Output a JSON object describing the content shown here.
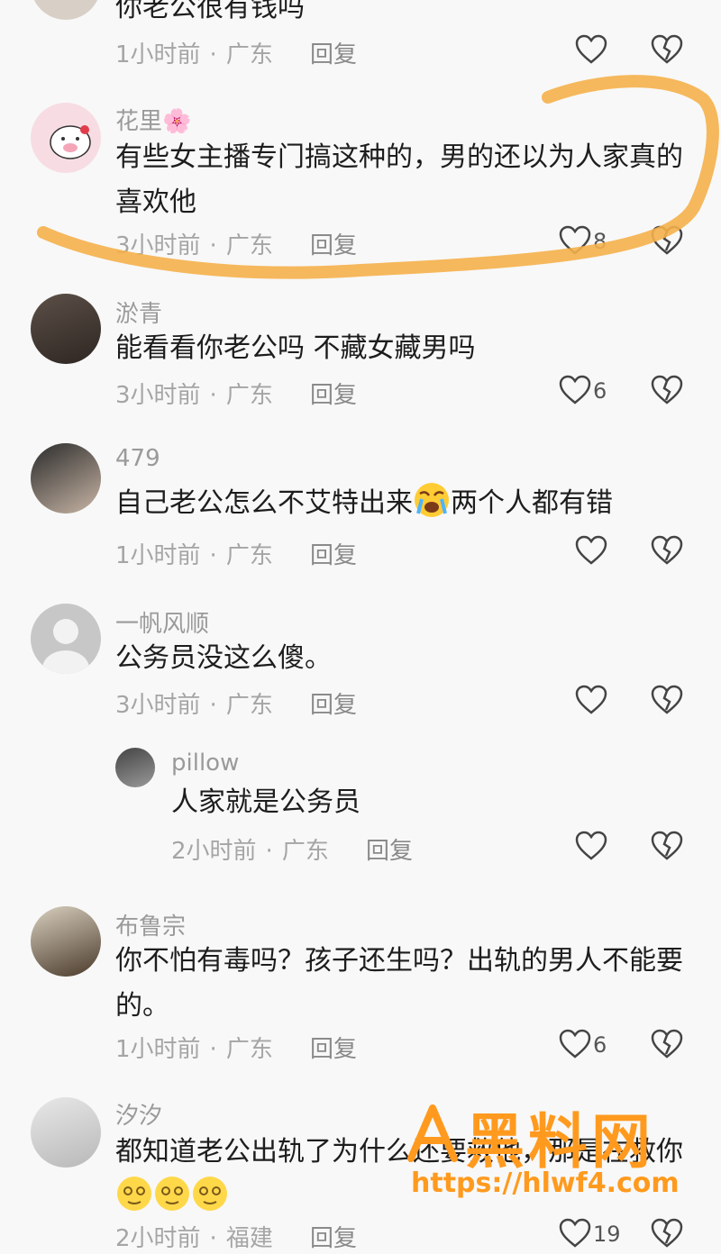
{
  "comments": [
    {
      "username": "",
      "text": "你老公很有钱吗",
      "time": "1小时前",
      "location": "广东",
      "reply": "回复",
      "likes": ""
    },
    {
      "username": "花里🌸",
      "text": "有些女主播专门搞这种的，男的还以为人家真的喜欢他",
      "time": "3小时前",
      "location": "广东",
      "reply": "回复",
      "likes": "8"
    },
    {
      "username": "淤青",
      "text": "能看看你老公吗 不藏女藏男吗",
      "time": "3小时前",
      "location": "广东",
      "reply": "回复",
      "likes": "6"
    },
    {
      "username": "479",
      "text_before": "自己老公怎么不艾特出来",
      "text_after": "两个人都有错",
      "time": "1小时前",
      "location": "广东",
      "reply": "回复",
      "likes": ""
    },
    {
      "username": "一帆风顺",
      "text": "公务员没这么傻。",
      "time": "3小时前",
      "location": "广东",
      "reply": "回复",
      "likes": ""
    },
    {
      "username": "pillow",
      "text": "人家就是公务员",
      "time": "2小时前",
      "location": "广东",
      "reply": "回复",
      "likes": ""
    },
    {
      "username": "布鲁宗",
      "text": "你不怕有毒吗？孩子还生吗？出轨的男人不能要的。",
      "time": "1小时前",
      "location": "广东",
      "reply": "回复",
      "likes": "6"
    },
    {
      "username": "汐汐",
      "text": "都知道老公出轨了为什么还要救他，那是在救你",
      "time": "2小时前",
      "location": "福建",
      "reply": "回复",
      "likes": "19"
    }
  ],
  "watermark": {
    "title": "黑料网",
    "url": "https://hlwf4.com"
  },
  "colors": {
    "highlight": "#f5b04a",
    "accent": "#ff9a1e"
  }
}
